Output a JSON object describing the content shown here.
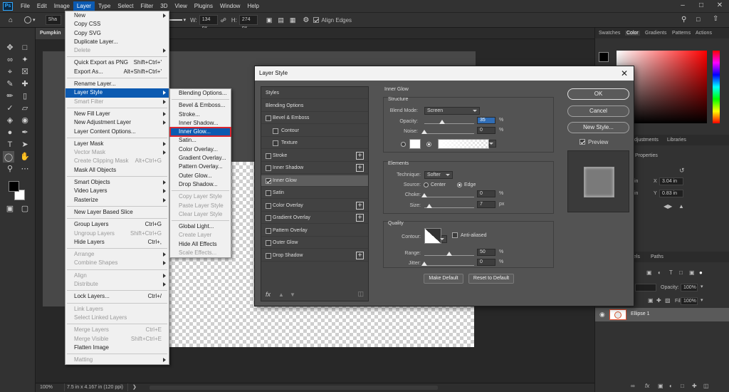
{
  "menubar": {
    "items": [
      "File",
      "Edit",
      "Image",
      "Layer",
      "Type",
      "Select",
      "Filter",
      "3D",
      "View",
      "Plugins",
      "Window",
      "Help"
    ],
    "active": "Layer"
  },
  "options": {
    "shape_label": "Sha",
    "w_label": "W:",
    "w_value": "134 px",
    "h_label": "H:",
    "h_value": "274 px",
    "align_edges": "Align Edges"
  },
  "document": {
    "tab": "Pumpkin",
    "zoom": "100%",
    "size": "7.5 in x 4.167 in (120 ppi)"
  },
  "layer_menu": [
    {
      "label": "New",
      "sub": true
    },
    {
      "label": "Copy CSS"
    },
    {
      "label": "Copy SVG"
    },
    {
      "label": "Duplicate Layer..."
    },
    {
      "label": "Delete",
      "sub": true,
      "disabled": true
    },
    {
      "sep": true
    },
    {
      "label": "Quick Export as PNG",
      "shortcut": "Shift+Ctrl+'"
    },
    {
      "label": "Export As...",
      "shortcut": "Alt+Shift+Ctrl+'"
    },
    {
      "sep": true
    },
    {
      "label": "Rename Layer..."
    },
    {
      "label": "Layer Style",
      "sub": true,
      "selected": true
    },
    {
      "label": "Smart Filter",
      "sub": true,
      "disabled": true
    },
    {
      "sep": true
    },
    {
      "label": "New Fill Layer",
      "sub": true
    },
    {
      "label": "New Adjustment Layer",
      "sub": true
    },
    {
      "label": "Layer Content Options..."
    },
    {
      "sep": true
    },
    {
      "label": "Layer Mask",
      "sub": true
    },
    {
      "label": "Vector Mask",
      "sub": true,
      "disabled": true
    },
    {
      "label": "Create Clipping Mask",
      "shortcut": "Alt+Ctrl+G",
      "disabled": true
    },
    {
      "label": "Mask All Objects"
    },
    {
      "sep": true
    },
    {
      "label": "Smart Objects",
      "sub": true
    },
    {
      "label": "Video Layers",
      "sub": true
    },
    {
      "label": "Rasterize",
      "sub": true
    },
    {
      "sep": true
    },
    {
      "label": "New Layer Based Slice"
    },
    {
      "sep": true
    },
    {
      "label": "Group Layers",
      "shortcut": "Ctrl+G"
    },
    {
      "label": "Ungroup Layers",
      "shortcut": "Shift+Ctrl+G",
      "disabled": true
    },
    {
      "label": "Hide Layers",
      "shortcut": "Ctrl+,"
    },
    {
      "sep": true
    },
    {
      "label": "Arrange",
      "sub": true,
      "disabled": true
    },
    {
      "label": "Combine Shapes",
      "sub": true,
      "disabled": true
    },
    {
      "sep": true
    },
    {
      "label": "Align",
      "sub": true,
      "disabled": true
    },
    {
      "label": "Distribute",
      "sub": true,
      "disabled": true
    },
    {
      "sep": true
    },
    {
      "label": "Lock Layers...",
      "shortcut": "Ctrl+/"
    },
    {
      "sep": true
    },
    {
      "label": "Link Layers",
      "disabled": true
    },
    {
      "label": "Select Linked Layers",
      "disabled": true
    },
    {
      "sep": true
    },
    {
      "label": "Merge Layers",
      "shortcut": "Ctrl+E",
      "disabled": true
    },
    {
      "label": "Merge Visible",
      "shortcut": "Shift+Ctrl+E",
      "disabled": true
    },
    {
      "label": "Flatten Image"
    },
    {
      "sep": true
    },
    {
      "label": "Matting",
      "sub": true,
      "disabled": true
    }
  ],
  "style_submenu": [
    {
      "label": "Blending Options..."
    },
    {
      "sep": true
    },
    {
      "label": "Bevel & Emboss..."
    },
    {
      "label": "Stroke..."
    },
    {
      "label": "Inner Shadow..."
    },
    {
      "label": "Inner Glow...",
      "highlight": true
    },
    {
      "label": "Satin..."
    },
    {
      "label": "Color Overlay..."
    },
    {
      "label": "Gradient Overlay..."
    },
    {
      "label": "Pattern Overlay..."
    },
    {
      "label": "Outer Glow..."
    },
    {
      "label": "Drop Shadow..."
    },
    {
      "sep": true
    },
    {
      "label": "Copy Layer Style",
      "disabled": true
    },
    {
      "label": "Paste Layer Style",
      "disabled": true
    },
    {
      "label": "Clear Layer Style",
      "disabled": true
    },
    {
      "sep": true
    },
    {
      "label": "Global Light..."
    },
    {
      "label": "Create Layer",
      "disabled": true
    },
    {
      "label": "Hide All Effects"
    },
    {
      "label": "Scale Effects...",
      "disabled": true
    }
  ],
  "dialog": {
    "title": "Layer Style",
    "styles": [
      {
        "label": "Styles",
        "kind": "header"
      },
      {
        "label": "Blending Options",
        "kind": "header"
      },
      {
        "label": "Bevel & Emboss",
        "check": false
      },
      {
        "label": "Contour",
        "check": false,
        "indent": true
      },
      {
        "label": "Texture",
        "check": false,
        "indent": true
      },
      {
        "label": "Stroke",
        "check": false,
        "plus": true
      },
      {
        "label": "Inner Shadow",
        "check": false,
        "plus": true
      },
      {
        "label": "Inner Glow",
        "check": true,
        "active": true
      },
      {
        "label": "Satin",
        "check": false
      },
      {
        "label": "Color Overlay",
        "check": false,
        "plus": true
      },
      {
        "label": "Gradient Overlay",
        "check": false,
        "plus": true
      },
      {
        "label": "Pattern Overlay",
        "check": false
      },
      {
        "label": "Outer Glow",
        "check": false
      },
      {
        "label": "Drop Shadow",
        "check": false,
        "plus": true
      }
    ],
    "fx_label": "fx",
    "inner_glow": {
      "title": "Inner Glow",
      "structure": "Structure",
      "blend_mode_label": "Blend Mode:",
      "blend_mode": "Screen",
      "opacity_label": "Opacity:",
      "opacity": "35",
      "noise_label": "Noise:",
      "noise": "0",
      "elements": "Elements",
      "technique_label": "Technique:",
      "technique": "Softer",
      "source_label": "Source:",
      "source_center": "Center",
      "source_edge": "Edge",
      "choke_label": "Choke:",
      "choke": "0",
      "size_label": "Size:",
      "size": "7",
      "quality": "Quality",
      "contour_label": "Contour:",
      "anti_aliased": "Anti-aliased",
      "range_label": "Range:",
      "range": "50",
      "jitter_label": "Jitter:",
      "jitter": "0",
      "pct": "%",
      "px": "px",
      "make_default": "Make Default",
      "reset_default": "Reset to Default"
    },
    "ok": "OK",
    "cancel": "Cancel",
    "new_style": "New Style...",
    "preview": "Preview"
  },
  "panels": {
    "top_tabs": [
      "Swatches",
      "Color",
      "Gradients",
      "Patterns",
      "Actions"
    ],
    "mid_tabs": [
      "djustments",
      "Libraries"
    ],
    "properties": "Properties",
    "x_label": "X",
    "x_value": "3.04 in",
    "y_label": "Y",
    "y_value": "0.83 in",
    "in_label": "in",
    "layer_tabs": [
      "nels",
      "Paths"
    ],
    "opacity_label": "Opacity:",
    "opacity_value": "100%",
    "fill_label": "Fill:",
    "fill_value": "100%",
    "layer_name": "Ellipse 1"
  }
}
